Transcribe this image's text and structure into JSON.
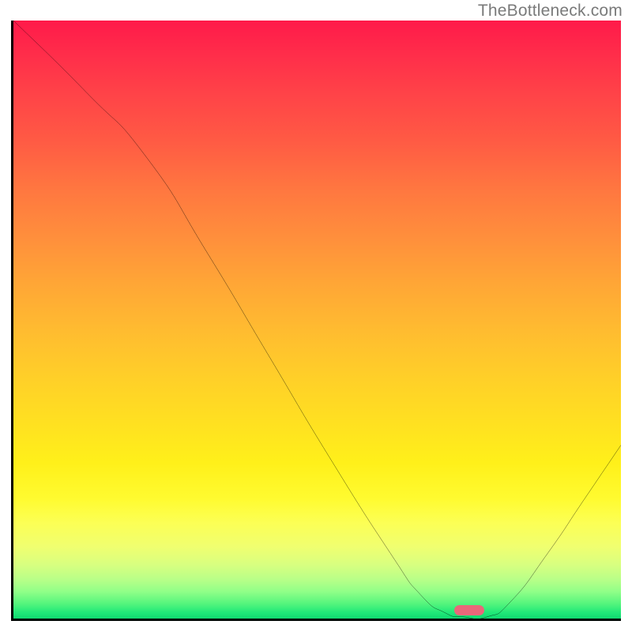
{
  "watermark": "TheBottleneck.com",
  "chart_data": {
    "type": "line",
    "title": "",
    "xlabel": "",
    "ylabel": "",
    "xlim": [
      0,
      100
    ],
    "ylim": [
      0,
      100
    ],
    "series": [
      {
        "name": "curve",
        "x": [
          0,
          12,
          22,
          32,
          42,
          52,
          62,
          67,
          71,
          74,
          78,
          82,
          88,
          94,
          100
        ],
        "values": [
          100,
          88,
          77,
          61,
          44,
          27,
          11,
          4,
          1,
          0.3,
          0.3,
          3,
          11,
          20,
          29
        ]
      }
    ],
    "marker": {
      "x": 75,
      "y": 1.4,
      "width": 5
    },
    "gradient": {
      "top_color": "#ff1a4a",
      "mid_color": "#ffd028",
      "bottom_color": "#10d870"
    }
  }
}
